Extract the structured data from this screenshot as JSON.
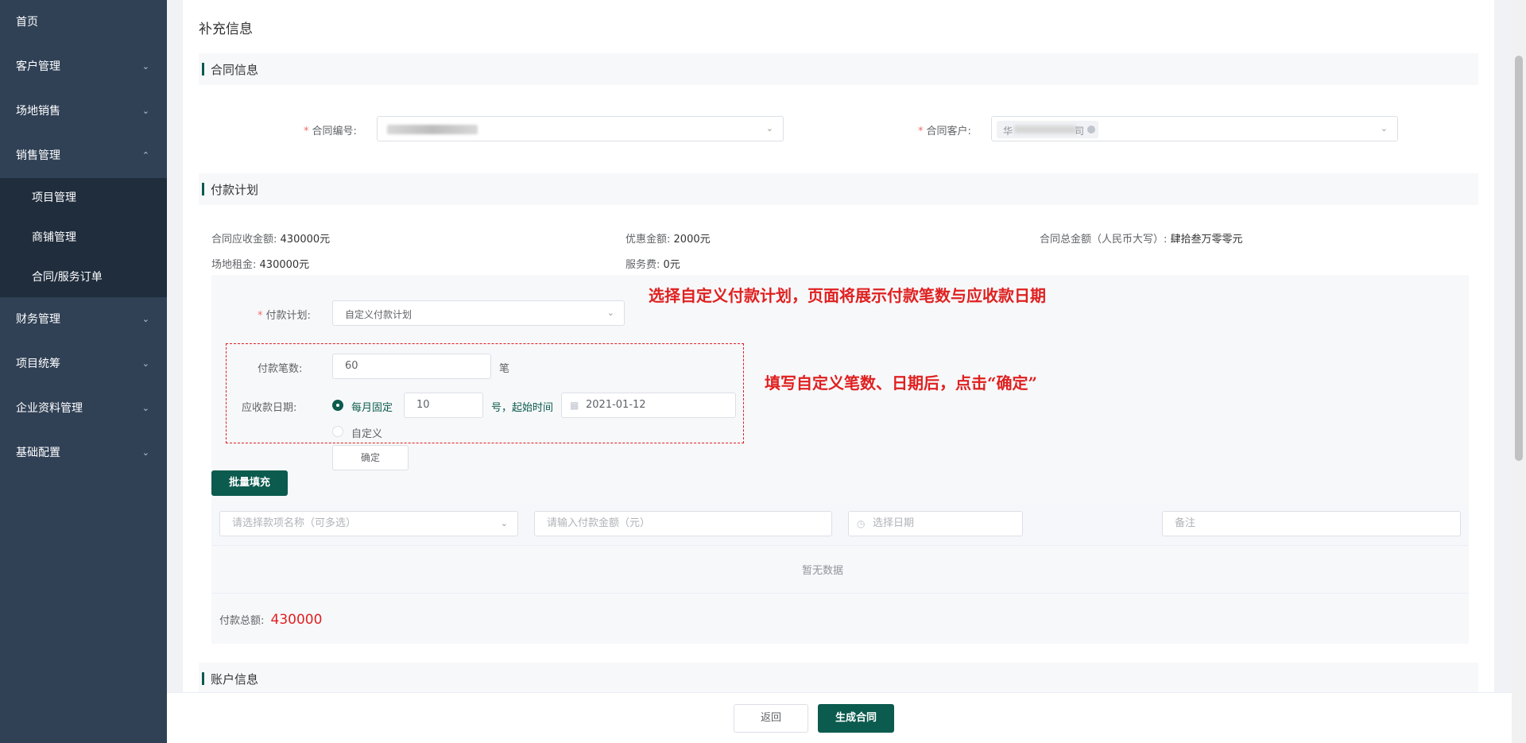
{
  "sidebar": {
    "items": [
      {
        "label": "首页"
      },
      {
        "label": "客户管理"
      },
      {
        "label": "场地销售"
      },
      {
        "label": "销售管理"
      },
      {
        "label": "财务管理"
      },
      {
        "label": "项目统筹"
      },
      {
        "label": "企业资料管理"
      },
      {
        "label": "基础配置"
      }
    ],
    "sub_items": [
      {
        "label": "项目管理"
      },
      {
        "label": "商铺管理"
      },
      {
        "label": "合同/服务订单"
      }
    ]
  },
  "page": {
    "title": "补充信息"
  },
  "sections": {
    "contract_info": "合同信息",
    "payment_plan": "付款计划",
    "account_info": "账户信息"
  },
  "contract_form": {
    "required_mark": "*",
    "number_label": "合同编号:",
    "customer_label": "合同客户:",
    "customer_tag_prefix": "华",
    "customer_tag_suffix": "司"
  },
  "amounts": {
    "receivable_label": "合同应收金额:",
    "receivable_value": "430000元",
    "discount_label": "优惠金额:",
    "discount_value": "2000元",
    "total_cn_label": "合同总金额（人民币大写）:",
    "total_cn_value": "肆拾叁万零零元",
    "rent_label": "场地租金:",
    "rent_value": "430000元",
    "service_label": "服务费:",
    "service_value": "0元"
  },
  "plan_form": {
    "plan_label": "付款计划:",
    "plan_value": "自定义付款计划",
    "count_label": "付款笔数:",
    "count_value": "60",
    "count_unit": "笔",
    "date_label": "应收款日期:",
    "monthly_label": "每月固定",
    "day_value": "10",
    "day_suffix": "号，起始时间",
    "start_date": "2021-01-12",
    "custom_label": "自定义",
    "confirm_label": "确定",
    "batch_fill_label": "批量填充"
  },
  "annotations": {
    "top": "选择自定义付款计划，页面将展示付款笔数与应收款日期",
    "side": "填写自定义笔数、日期后，点击“确定”"
  },
  "filters": {
    "name_placeholder": "请选择款项名称（可多选）",
    "amount_placeholder": "请输入付款金额（元）",
    "date_placeholder": "选择日期",
    "remark_placeholder": "备注"
  },
  "table": {
    "empty_text": "暂无数据"
  },
  "totals": {
    "label": "付款总额:",
    "value": "430000"
  },
  "footer": {
    "back_label": "返回",
    "generate_label": "生成合同"
  },
  "colors": {
    "primary": "#0b5b4e",
    "sidebar": "#304156",
    "annotation": "#e02020"
  }
}
